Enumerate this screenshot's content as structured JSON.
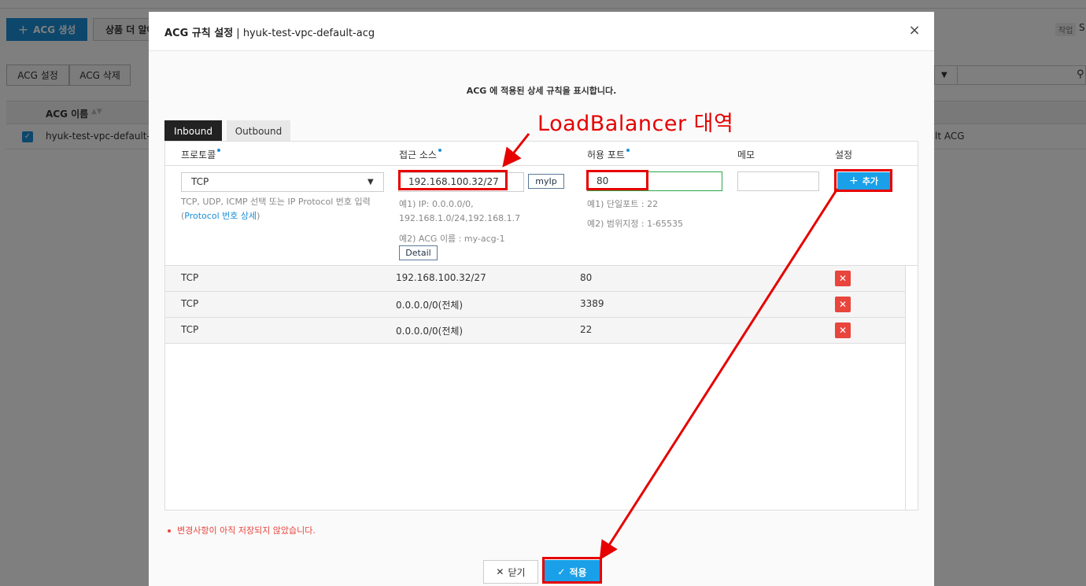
{
  "background": {
    "create_button": "ACG 생성",
    "more_button": "상품 더 알아",
    "right_tag": "작업",
    "right_letter": "S",
    "acg_settings_button": "ACG 설정",
    "acg_delete_button": "ACG 삭제",
    "table_header_name": "ACG 이름",
    "row_name": "hyuk-test-vpc-default-acg",
    "row_right": "lt ACG"
  },
  "modal": {
    "title_bold": "ACG 규칙 설정",
    "title_rest": " | hyuk-test-vpc-default-acg",
    "close_glyph": "×",
    "description": "ACG 에 적용된 상세 규칙을 표시합니다.",
    "tabs": {
      "inbound": "Inbound",
      "outbound": "Outbound"
    },
    "columns": {
      "protocol": "프로토콜",
      "source": "접근 소스",
      "port": "허용 포트",
      "memo": "메모",
      "settings": "설정"
    },
    "form": {
      "protocol_value": "TCP",
      "protocol_help_1": "TCP, UDP, ICMP 선택 또는 IP Protocol 번호 입력",
      "protocol_help_open": "(",
      "protocol_help_link": "Protocol 번호 상세",
      "protocol_help_close": ")",
      "source_value": "192.168.100.32/27",
      "myip_button": "myIp",
      "source_help_1": "예1) IP: 0.0.0.0/0,",
      "source_help_2": "192.168.1.0/24,192.168.1.7",
      "source_help_3": "예2) ACG 이름 : my-acg-1",
      "detail_button": "Detail",
      "port_value": "80",
      "port_help_1": "예1) 단일포트 : 22",
      "port_help_2": "예2) 범위지정 : 1-65535",
      "memo_value": "",
      "add_button": "추가"
    },
    "rules": [
      {
        "protocol": "TCP",
        "source": "192.168.100.32/27",
        "port": "80"
      },
      {
        "protocol": "TCP",
        "source": "0.0.0.0/0(전체)",
        "port": "3389"
      },
      {
        "protocol": "TCP",
        "source": "0.0.0.0/0(전체)",
        "port": "22"
      }
    ],
    "unsaved_message": "변경사항이 아직 저장되지 않았습니다.",
    "close_button": "닫기",
    "apply_button": "적용"
  },
  "annotation": {
    "label": "LoadBalancer 대역",
    "color": "#e60000"
  },
  "colors": {
    "primary": "#1a8fd8",
    "danger": "#e8453c",
    "valid_border": "#2aa84a"
  }
}
